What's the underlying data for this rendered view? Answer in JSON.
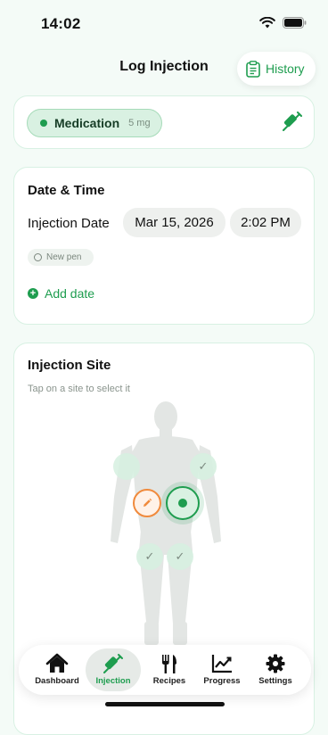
{
  "status": {
    "time": "14:02"
  },
  "header": {
    "title": "Log Injection",
    "history_label": "History"
  },
  "medication": {
    "name": "Medication",
    "dose": "5 mg"
  },
  "date_time": {
    "title": "Date & Time",
    "row_label": "Injection Date",
    "date_value": "Mar 15, 2026",
    "time_value": "2:02 PM",
    "new_pen_label": "New pen",
    "add_date_label": "Add date"
  },
  "injection_site": {
    "title": "Injection Site",
    "subtitle": "Tap on a site to select it"
  },
  "tabs": [
    {
      "label": "Dashboard",
      "icon": "home-icon",
      "active": false
    },
    {
      "label": "Injection",
      "icon": "syringe-icon",
      "active": true
    },
    {
      "label": "Recipes",
      "icon": "fork-knife-icon",
      "active": false
    },
    {
      "label": "Progress",
      "icon": "chart-icon",
      "active": false
    },
    {
      "label": "Settings",
      "icon": "gear-icon",
      "active": false
    }
  ],
  "colors": {
    "accent": "#1e9d4f",
    "suggest": "#f08a3c",
    "background": "#f4fbf7"
  }
}
